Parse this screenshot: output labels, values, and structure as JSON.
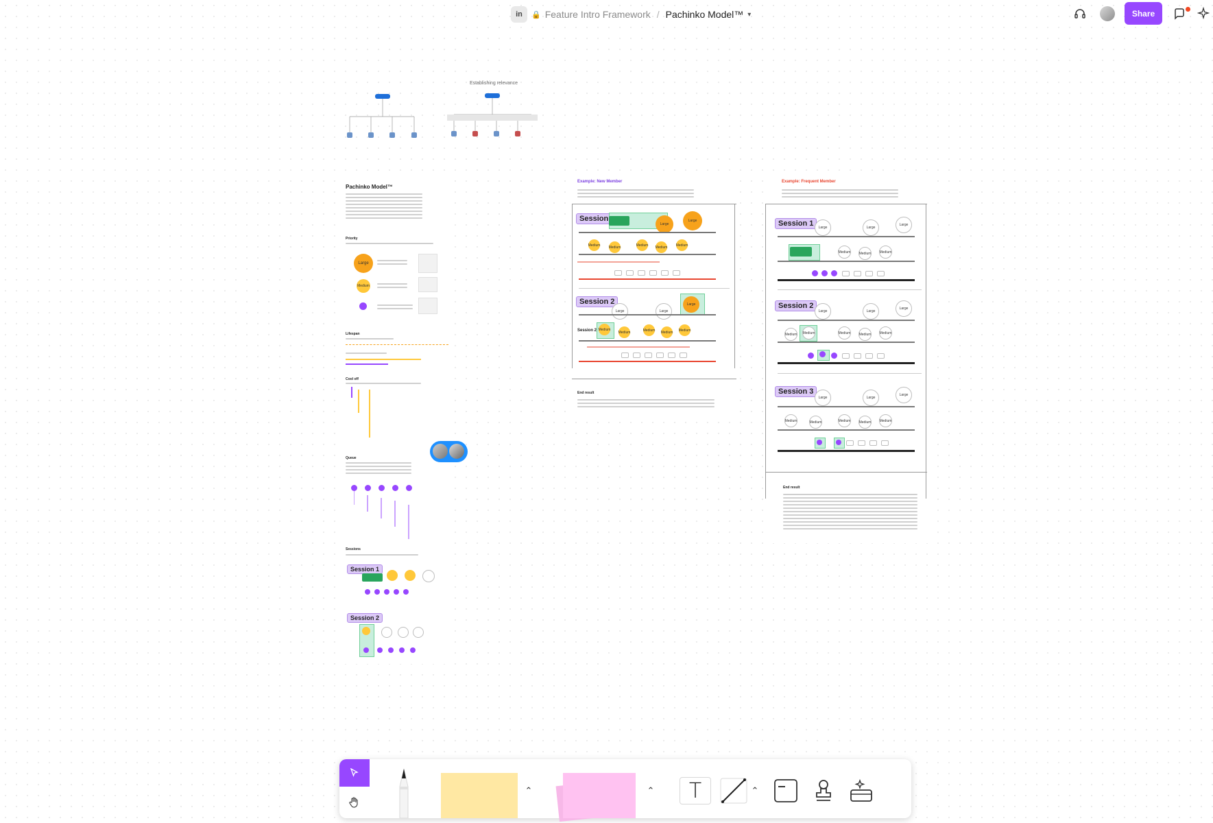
{
  "header": {
    "parent": "Feature Intro Framework",
    "separator": "/",
    "title": "Pachinko Model™",
    "share_label": "Share",
    "file_icon_text": "in"
  },
  "flows": {
    "title": "Establishing relevance"
  },
  "pachinko": {
    "title": "Pachinko Model™",
    "priority_heading": "Priority",
    "large": "Large",
    "medium": "Medium",
    "lifespan_heading": "Lifespan",
    "cooloff_heading": "Cool off",
    "queue_heading": "Queue",
    "sessions_heading": "Sessions",
    "session1": "Session 1",
    "session2": "Session 2"
  },
  "new_member": {
    "heading": "Example: New Member",
    "session1": "Session 1",
    "session2": "Session 2",
    "session2_small": "Session 2",
    "large": "Large",
    "medium": "Medium",
    "end_heading": "End result"
  },
  "frequent_member": {
    "heading": "Example: Frequent Member",
    "session1": "Session 1",
    "session2": "Session 2",
    "session3": "Session 3",
    "large": "Large",
    "medium": "Medium",
    "end_heading": "End result"
  },
  "toolbar": {
    "tools": [
      "select",
      "hand",
      "pen",
      "sticky-yellow",
      "sticky-pink",
      "text",
      "connector",
      "section",
      "stamp",
      "ai-widgets"
    ],
    "text_glyph": "T"
  },
  "colors": {
    "accent": "#9747ff",
    "large": "#f7a21b",
    "medium": "#ffc83a",
    "sticky_yellow": "#ffe8a3",
    "sticky_pink": "#ffc2f1",
    "notification": "#f24822"
  }
}
